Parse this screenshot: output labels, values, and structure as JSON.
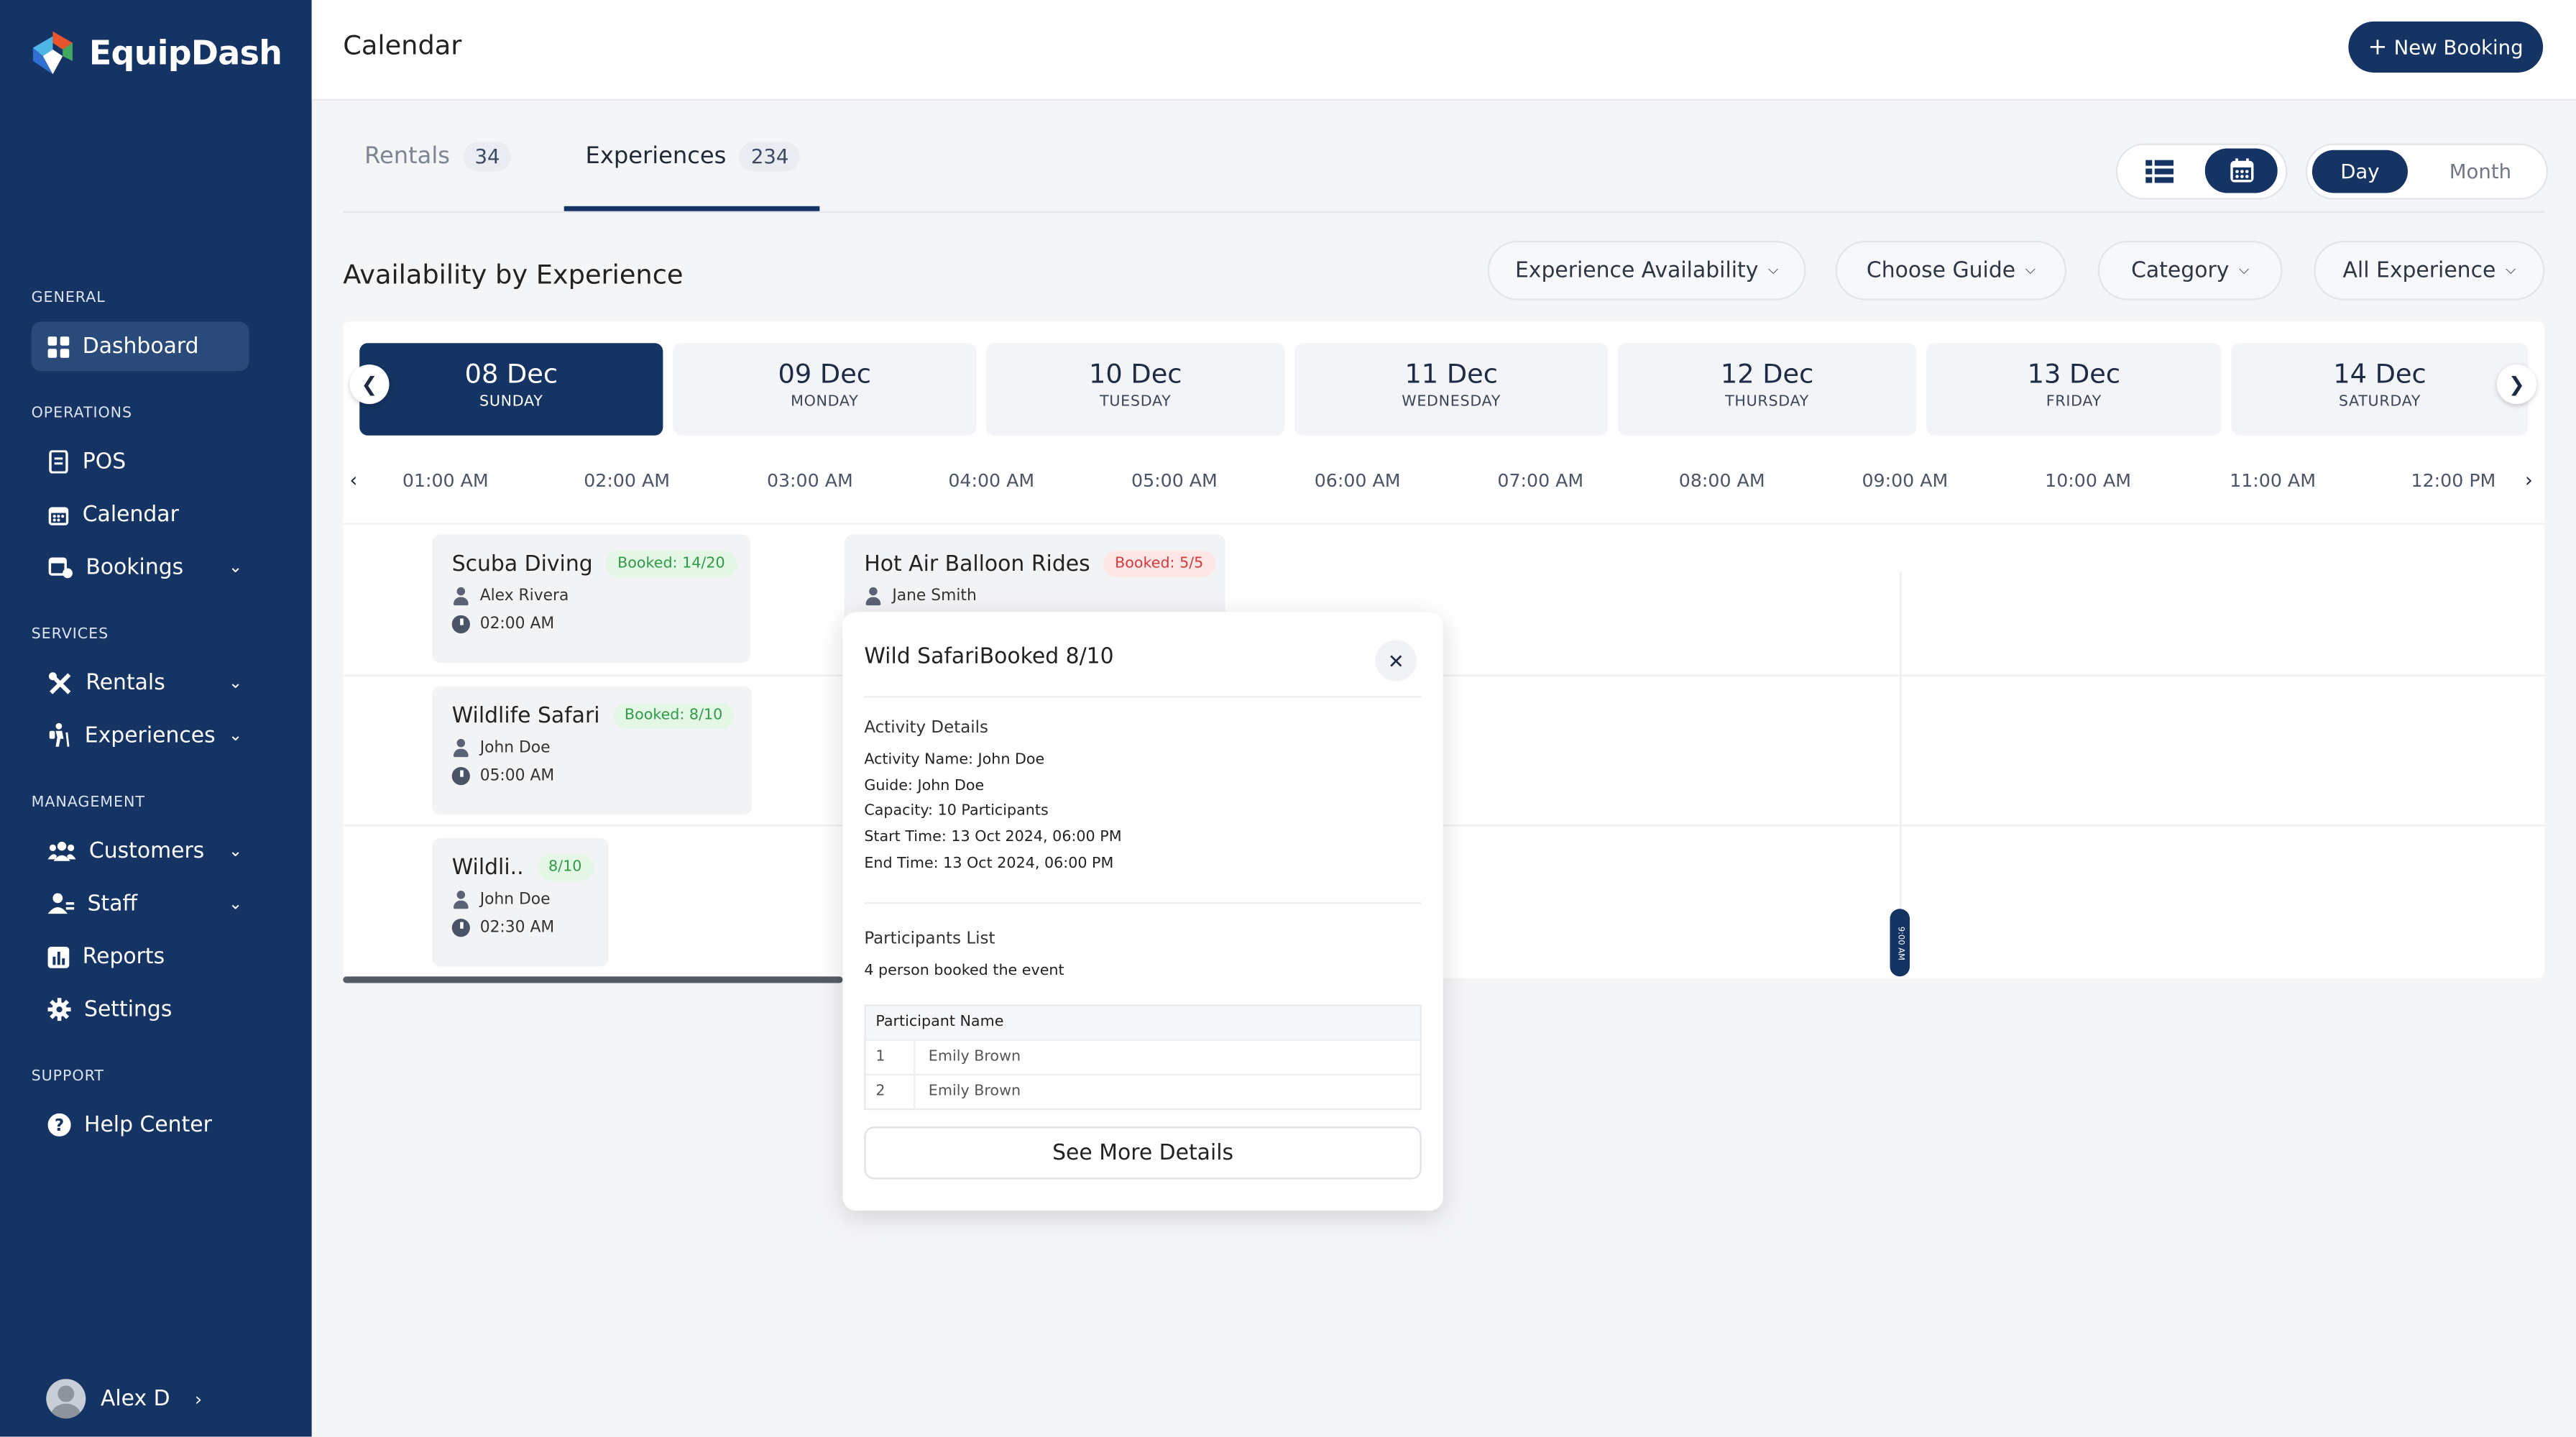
{
  "app": {
    "name": "EquipDash",
    "brand_color": "#153463"
  },
  "sidebar": {
    "sections": {
      "general": "GENERAL",
      "operations": "OPERATIONS",
      "services": "SERVICES",
      "management": "MANAGEMENT",
      "support": "SUPPORT"
    },
    "items": [
      {
        "label": "Dashboard",
        "icon": "grid-icon",
        "active": true
      },
      {
        "label": "POS",
        "icon": "receipt-icon"
      },
      {
        "label": "Calendar",
        "icon": "calendar-icon"
      },
      {
        "label": "Bookings",
        "icon": "bookings-icon",
        "expandable": true
      },
      {
        "label": "Rentals",
        "icon": "tools-icon",
        "expandable": true
      },
      {
        "label": "Experiences",
        "icon": "hiker-icon",
        "expandable": true
      },
      {
        "label": "Customers",
        "icon": "users-icon",
        "expandable": true
      },
      {
        "label": "Staff",
        "icon": "staff-icon",
        "expandable": true
      },
      {
        "label": "Reports",
        "icon": "chart-icon"
      },
      {
        "label": "Settings",
        "icon": "gear-icon"
      },
      {
        "label": "Help Center",
        "icon": "help-icon"
      }
    ],
    "user": {
      "name": "Alex D"
    }
  },
  "header": {
    "title": "Calendar",
    "new_booking": "New Booking"
  },
  "tabs": [
    {
      "label": "Rentals",
      "count": "34",
      "active": false
    },
    {
      "label": "Experiences",
      "count": "234",
      "active": true
    }
  ],
  "view": {
    "mode_day": "Day",
    "mode_month": "Month",
    "selected": "Day"
  },
  "availability": {
    "title": "Availability by Experience",
    "filters": [
      "Experience Availability",
      "Choose Guide",
      "Category",
      "All Experience"
    ]
  },
  "dates": [
    {
      "date": "08 Dec",
      "weekday": "SUNDAY",
      "active": true
    },
    {
      "date": "09 Dec",
      "weekday": "MONDAY"
    },
    {
      "date": "10 Dec",
      "weekday": "TUESDAY"
    },
    {
      "date": "11 Dec",
      "weekday": "WEDNESDAY"
    },
    {
      "date": "12 Dec",
      "weekday": "THURSDAY"
    },
    {
      "date": "13 Dec",
      "weekday": "FRIDAY"
    },
    {
      "date": "14 Dec",
      "weekday": "SATURDAY"
    }
  ],
  "times": [
    "01:00 AM",
    "02:00 AM",
    "03:00 AM",
    "04:00 AM",
    "05:00 AM",
    "06:00 AM",
    "07:00 AM",
    "08:00 AM",
    "09:00 AM",
    "10:00 AM",
    "11:00 AM",
    "12:00 PM"
  ],
  "now_marker": "9:00 AM",
  "events": [
    {
      "title": "Scuba Diving",
      "badge": "Booked: 14/20",
      "status": "green",
      "guide": "Alex Rivera",
      "time": "02:00 AM"
    },
    {
      "title": "Hot Air Balloon Rides",
      "badge": "Booked: 5/5",
      "status": "red",
      "guide": "Jane Smith"
    },
    {
      "title": "Wildlife Safari",
      "badge": "Booked: 8/10",
      "status": "green",
      "guide": "John Doe",
      "time": "05:00 AM"
    },
    {
      "title": "Wildli..",
      "badge": "8/10",
      "status": "green",
      "guide": "John Doe",
      "time": "02:30 AM"
    }
  ],
  "popup": {
    "title": "Wild SafariBooked 8/10",
    "activity_heading": "Activity Details",
    "details": [
      "Activity Name: John Doe",
      "Guide: John Doe",
      "Capacity: 10 Participants",
      "Start Time: 13 Oct 2024, 06:00 PM",
      "End Time: 13 Oct 2024, 06:00 PM"
    ],
    "participants_heading": "Participants List",
    "participants_summary": "4 person booked the event",
    "table_header": "Participant Name",
    "participants": [
      {
        "no": "1",
        "name": "Emily Brown"
      },
      {
        "no": "2",
        "name": "Emily Brown"
      }
    ],
    "see_more": "See More Details"
  }
}
